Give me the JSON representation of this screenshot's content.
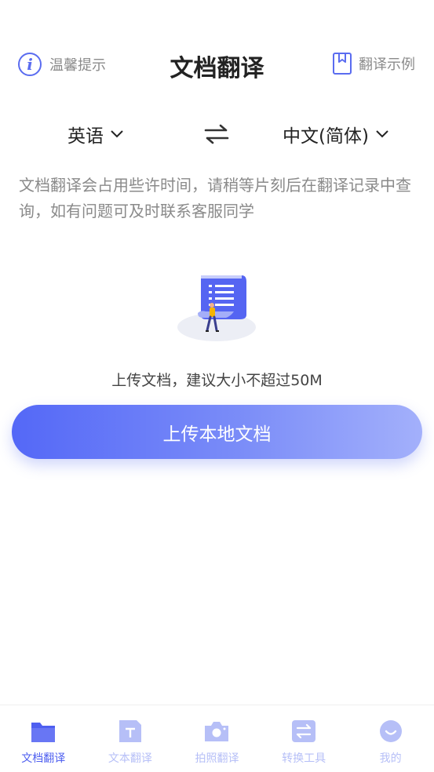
{
  "header": {
    "tip_label": "温馨提示",
    "title": "文档翻译",
    "example_label": "翻译示例"
  },
  "languages": {
    "source": "英语",
    "target": "中文(简体)"
  },
  "notice": "文档翻译会占用些许时间，请稍等片刻后在翻译记录中查询，如有问题可及时联系客服同学",
  "upload": {
    "hint": "上传文档，建议大小不超过50M",
    "button_label": "上传本地文档"
  },
  "tabs": [
    {
      "label": "文档翻译",
      "icon": "folder-icon",
      "active": true
    },
    {
      "label": "文本翻译",
      "icon": "text-doc-icon",
      "active": false
    },
    {
      "label": "拍照翻译",
      "icon": "camera-icon",
      "active": false
    },
    {
      "label": "转换工具",
      "icon": "convert-icon",
      "active": false
    },
    {
      "label": "我的",
      "icon": "smile-icon",
      "active": false
    }
  ],
  "colors": {
    "accent": "#4e5ff0",
    "accent_light": "#b6bff7",
    "text_muted": "#8a8a8a"
  }
}
